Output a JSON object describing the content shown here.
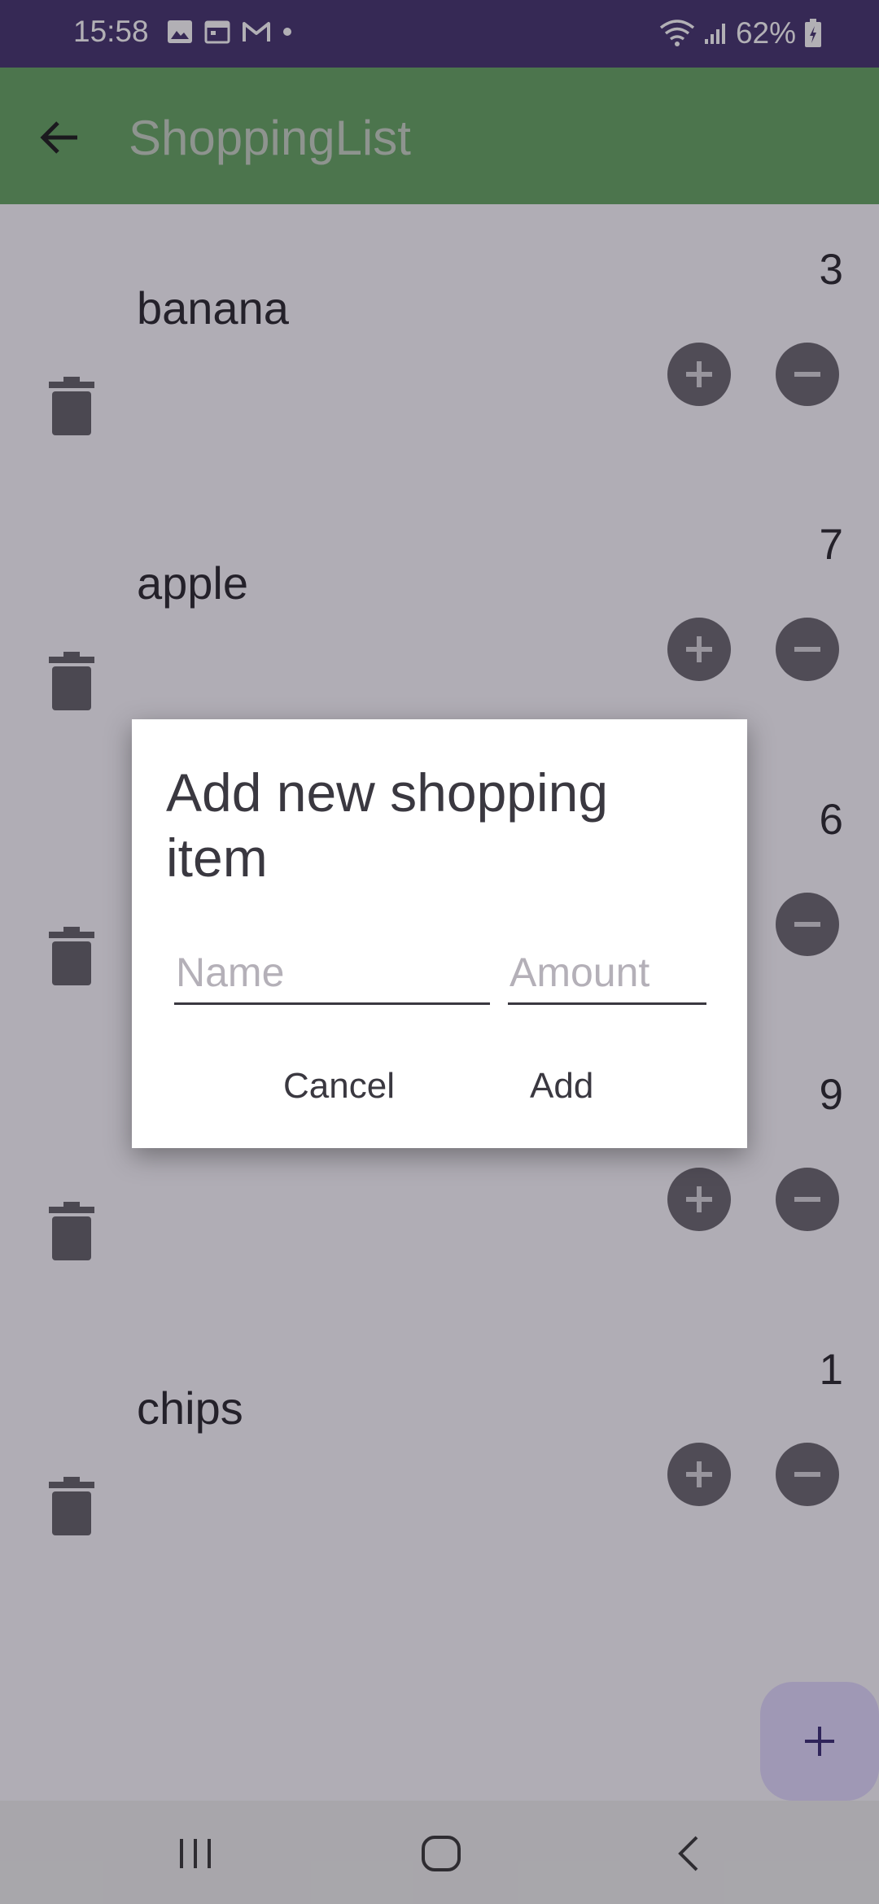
{
  "status_bar": {
    "time": "15:58",
    "battery": "62%"
  },
  "app_bar": {
    "title": "ShoppingList"
  },
  "items": [
    {
      "name": "banana",
      "amount": "3"
    },
    {
      "name": "apple",
      "amount": "7"
    },
    {
      "name": "",
      "amount": "6"
    },
    {
      "name": "",
      "amount": "9"
    },
    {
      "name": "chips",
      "amount": "1"
    }
  ],
  "dialog": {
    "title": "Add new shopping item",
    "name_placeholder": "Name",
    "amount_placeholder": "Amount",
    "cancel_label": "Cancel",
    "add_label": "Add"
  },
  "colors": {
    "status_bar": "#473670",
    "app_bar": "#67a864",
    "fab": "#e3dbff",
    "round_button": "#6d6b72"
  }
}
